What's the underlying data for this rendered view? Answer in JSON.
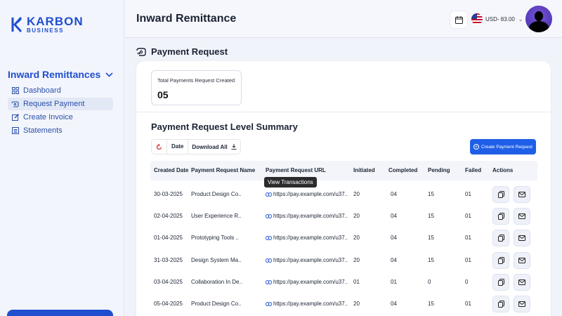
{
  "brand": {
    "name": "KARBON",
    "sub": "BUSINESS",
    "color": "#1f4fcf"
  },
  "sidebar": {
    "section_title": "Inward Remittances",
    "items": [
      {
        "label": "Dashboard",
        "icon": "dashboard-grid-icon"
      },
      {
        "label": "Request Payment",
        "icon": "request-payment-icon",
        "active": true
      },
      {
        "label": "Create Invoice",
        "icon": "edit-icon"
      },
      {
        "label": "Statements",
        "icon": "statements-icon"
      }
    ]
  },
  "header": {
    "title": "Inward Remittance",
    "currency": "USD- 83.00"
  },
  "main": {
    "section_title": "Payment Request",
    "stat": {
      "label": "Total Payments Request Created",
      "value": "05"
    },
    "summary_title": "Payment Request Level Summary",
    "toolbar": {
      "date_label": "Date",
      "download_label": "Download All"
    },
    "create_button": "Create Payment Request",
    "tooltip": "View Transactions",
    "columns": [
      "Created Date",
      "Payment Request Name",
      "Payment Request URL",
      "Initiated",
      "Completed",
      "Pending",
      "Failed",
      "Actions"
    ],
    "rows": [
      {
        "date": "30-03-2025",
        "name": "Product Design Co..",
        "url": "https://pay.example.com/u37..",
        "initiated": "20",
        "completed": "04",
        "pending": "15",
        "failed": "01"
      },
      {
        "date": "02-04-2025",
        "name": "User Experience R..",
        "url": "https://pay.example.com/u37..",
        "initiated": "20",
        "completed": "04",
        "pending": "15",
        "failed": "01"
      },
      {
        "date": "01-04-2025",
        "name": "Prototyping Tools ..",
        "url": "https://pay.example.com/u37..",
        "initiated": "20",
        "completed": "04",
        "pending": "15",
        "failed": "01"
      },
      {
        "date": "31-03-2025",
        "name": "Design System Ma..",
        "url": "https://pay.example.com/u37..",
        "initiated": "20",
        "completed": "04",
        "pending": "15",
        "failed": "01"
      },
      {
        "date": "03-04-2025",
        "name": "Collaboration In De..",
        "url": "https://pay.example.com/u37..",
        "initiated": "01",
        "completed": "01",
        "pending": "0",
        "failed": "0"
      },
      {
        "date": "05-04-2025",
        "name": "Product Design Co..",
        "url": "https://pay.example.com/u37..",
        "initiated": "20",
        "completed": "04",
        "pending": "15",
        "failed": "01"
      }
    ]
  }
}
